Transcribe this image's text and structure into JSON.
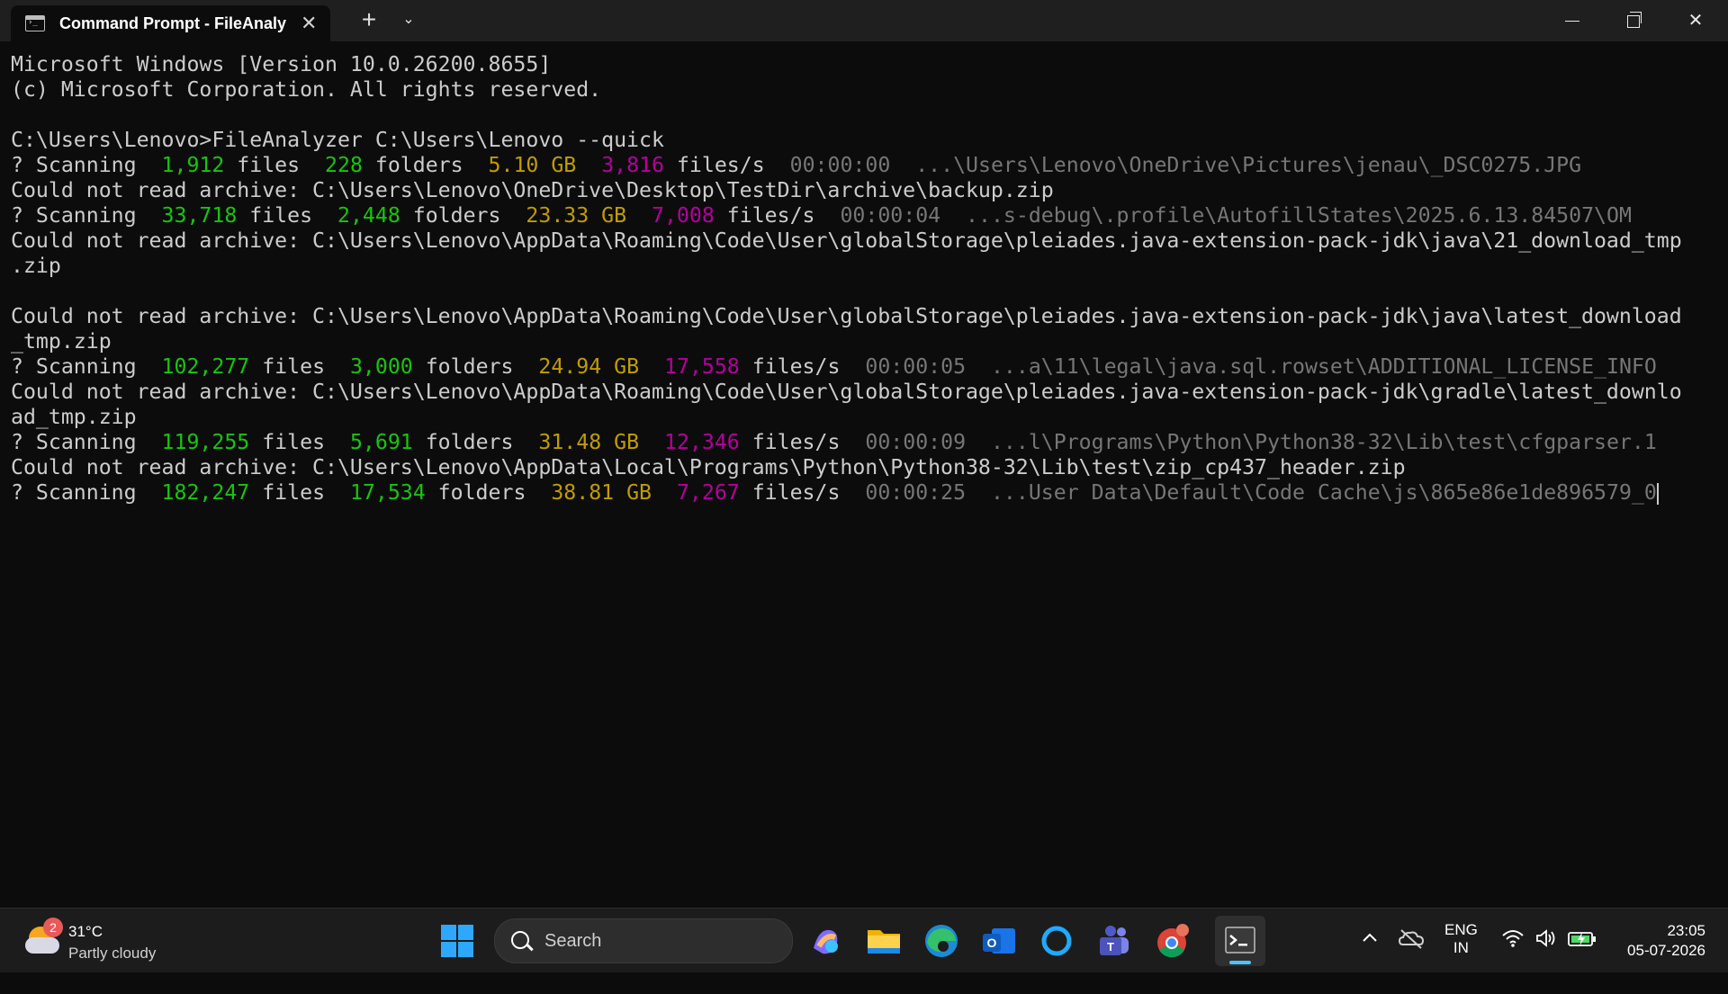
{
  "window": {
    "tab_title": "Command Prompt - FileAnaly",
    "new_tab": "+",
    "dropdown": "⌄",
    "minimize": "–",
    "maximize": "□",
    "close": "✕"
  },
  "terminal": {
    "lines": [
      {
        "segments": [
          {
            "t": "Microsoft Windows [Version 10.0.26200.8655]",
            "c": ""
          }
        ]
      },
      {
        "segments": [
          {
            "t": "(c) Microsoft Corporation. All rights reserved.",
            "c": ""
          }
        ]
      },
      {
        "segments": [
          {
            "t": "",
            "c": ""
          }
        ]
      },
      {
        "segments": [
          {
            "t": "C:\\Users\\Lenovo>FileAnalyzer C:\\Users\\Lenovo --quick",
            "c": ""
          }
        ]
      },
      {
        "segments": [
          {
            "t": "? Scanning  ",
            "c": ""
          },
          {
            "t": "1,912",
            "c": "g"
          },
          {
            "t": " files  ",
            "c": ""
          },
          {
            "t": "228",
            "c": "g"
          },
          {
            "t": " folders  ",
            "c": ""
          },
          {
            "t": "5.10 GB",
            "c": "y"
          },
          {
            "t": "  ",
            "c": ""
          },
          {
            "t": "3,816",
            "c": "m"
          },
          {
            "t": " files/s  ",
            "c": ""
          },
          {
            "t": "00:00:00  ...\\Users\\Lenovo\\OneDrive\\Pictures\\jenau\\_DSC0275.JPG",
            "c": "d"
          }
        ]
      },
      {
        "segments": [
          {
            "t": "Could not read archive: C:\\Users\\Lenovo\\OneDrive\\Desktop\\TestDir\\archive\\backup.zip",
            "c": ""
          }
        ]
      },
      {
        "segments": [
          {
            "t": "? Scanning  ",
            "c": ""
          },
          {
            "t": "33,718",
            "c": "g"
          },
          {
            "t": " files  ",
            "c": ""
          },
          {
            "t": "2,448",
            "c": "g"
          },
          {
            "t": " folders  ",
            "c": ""
          },
          {
            "t": "23.33 GB",
            "c": "y"
          },
          {
            "t": "  ",
            "c": ""
          },
          {
            "t": "7,008",
            "c": "m"
          },
          {
            "t": " files/s  ",
            "c": ""
          },
          {
            "t": "00:00:04  ...s-debug\\.profile\\AutofillStates\\2025.6.13.84507\\OM",
            "c": "d"
          }
        ]
      },
      {
        "segments": [
          {
            "t": "Could not read archive: C:\\Users\\Lenovo\\AppData\\Roaming\\Code\\User\\globalStorage\\pleiades.java-extension-pack-jdk\\java\\21_download_tmp",
            "c": ""
          }
        ]
      },
      {
        "segments": [
          {
            "t": ".zip",
            "c": ""
          }
        ]
      },
      {
        "segments": [
          {
            "t": "",
            "c": ""
          }
        ]
      },
      {
        "segments": [
          {
            "t": "Could not read archive: C:\\Users\\Lenovo\\AppData\\Roaming\\Code\\User\\globalStorage\\pleiades.java-extension-pack-jdk\\java\\latest_download",
            "c": ""
          }
        ]
      },
      {
        "segments": [
          {
            "t": "_tmp.zip",
            "c": ""
          }
        ]
      },
      {
        "segments": [
          {
            "t": "? Scanning  ",
            "c": ""
          },
          {
            "t": "102,277",
            "c": "g"
          },
          {
            "t": " files  ",
            "c": ""
          },
          {
            "t": "3,000",
            "c": "g"
          },
          {
            "t": " folders  ",
            "c": ""
          },
          {
            "t": "24.94 GB",
            "c": "y"
          },
          {
            "t": "  ",
            "c": ""
          },
          {
            "t": "17,558",
            "c": "m"
          },
          {
            "t": " files/s  ",
            "c": ""
          },
          {
            "t": "00:00:05  ...a\\11\\legal\\java.sql.rowset\\ADDITIONAL_LICENSE_INFO",
            "c": "d"
          }
        ]
      },
      {
        "segments": [
          {
            "t": "Could not read archive: C:\\Users\\Lenovo\\AppData\\Roaming\\Code\\User\\globalStorage\\pleiades.java-extension-pack-jdk\\gradle\\latest_downlo",
            "c": ""
          }
        ]
      },
      {
        "segments": [
          {
            "t": "ad_tmp.zip",
            "c": ""
          }
        ]
      },
      {
        "segments": [
          {
            "t": "? Scanning  ",
            "c": ""
          },
          {
            "t": "119,255",
            "c": "g"
          },
          {
            "t": " files  ",
            "c": ""
          },
          {
            "t": "5,691",
            "c": "g"
          },
          {
            "t": " folders  ",
            "c": ""
          },
          {
            "t": "31.48 GB",
            "c": "y"
          },
          {
            "t": "  ",
            "c": ""
          },
          {
            "t": "12,346",
            "c": "m"
          },
          {
            "t": " files/s  ",
            "c": ""
          },
          {
            "t": "00:00:09  ...l\\Programs\\Python\\Python38-32\\Lib\\test\\cfgparser.1",
            "c": "d"
          }
        ]
      },
      {
        "segments": [
          {
            "t": "Could not read archive: C:\\Users\\Lenovo\\AppData\\Local\\Programs\\Python\\Python38-32\\Lib\\test\\zip_cp437_header.zip",
            "c": ""
          }
        ]
      },
      {
        "segments": [
          {
            "t": "? Scanning  ",
            "c": ""
          },
          {
            "t": "182,247",
            "c": "g"
          },
          {
            "t": " files  ",
            "c": ""
          },
          {
            "t": "17,534",
            "c": "g"
          },
          {
            "t": " folders  ",
            "c": ""
          },
          {
            "t": "38.81 GB",
            "c": "y"
          },
          {
            "t": "  ",
            "c": ""
          },
          {
            "t": "7,267",
            "c": "m"
          },
          {
            "t": " files/s  ",
            "c": ""
          },
          {
            "t": "00:00:25  ...User Data\\Default\\Code Cache\\js\\865e86e1de896579_0",
            "c": "d"
          }
        ],
        "cursor": true
      }
    ]
  },
  "taskbar": {
    "weather": {
      "badge": "2",
      "temp": "31°C",
      "condition": "Partly cloudy"
    },
    "search_label": "Search",
    "lang_top": "ENG",
    "lang_bottom": "IN",
    "time": "23:05",
    "date": "05-07-2026"
  },
  "colors": {
    "green": "#16c60c",
    "yellow": "#c19c00",
    "magenta": "#b4009e",
    "dim": "#767676",
    "accent": "#4cc2ff"
  }
}
